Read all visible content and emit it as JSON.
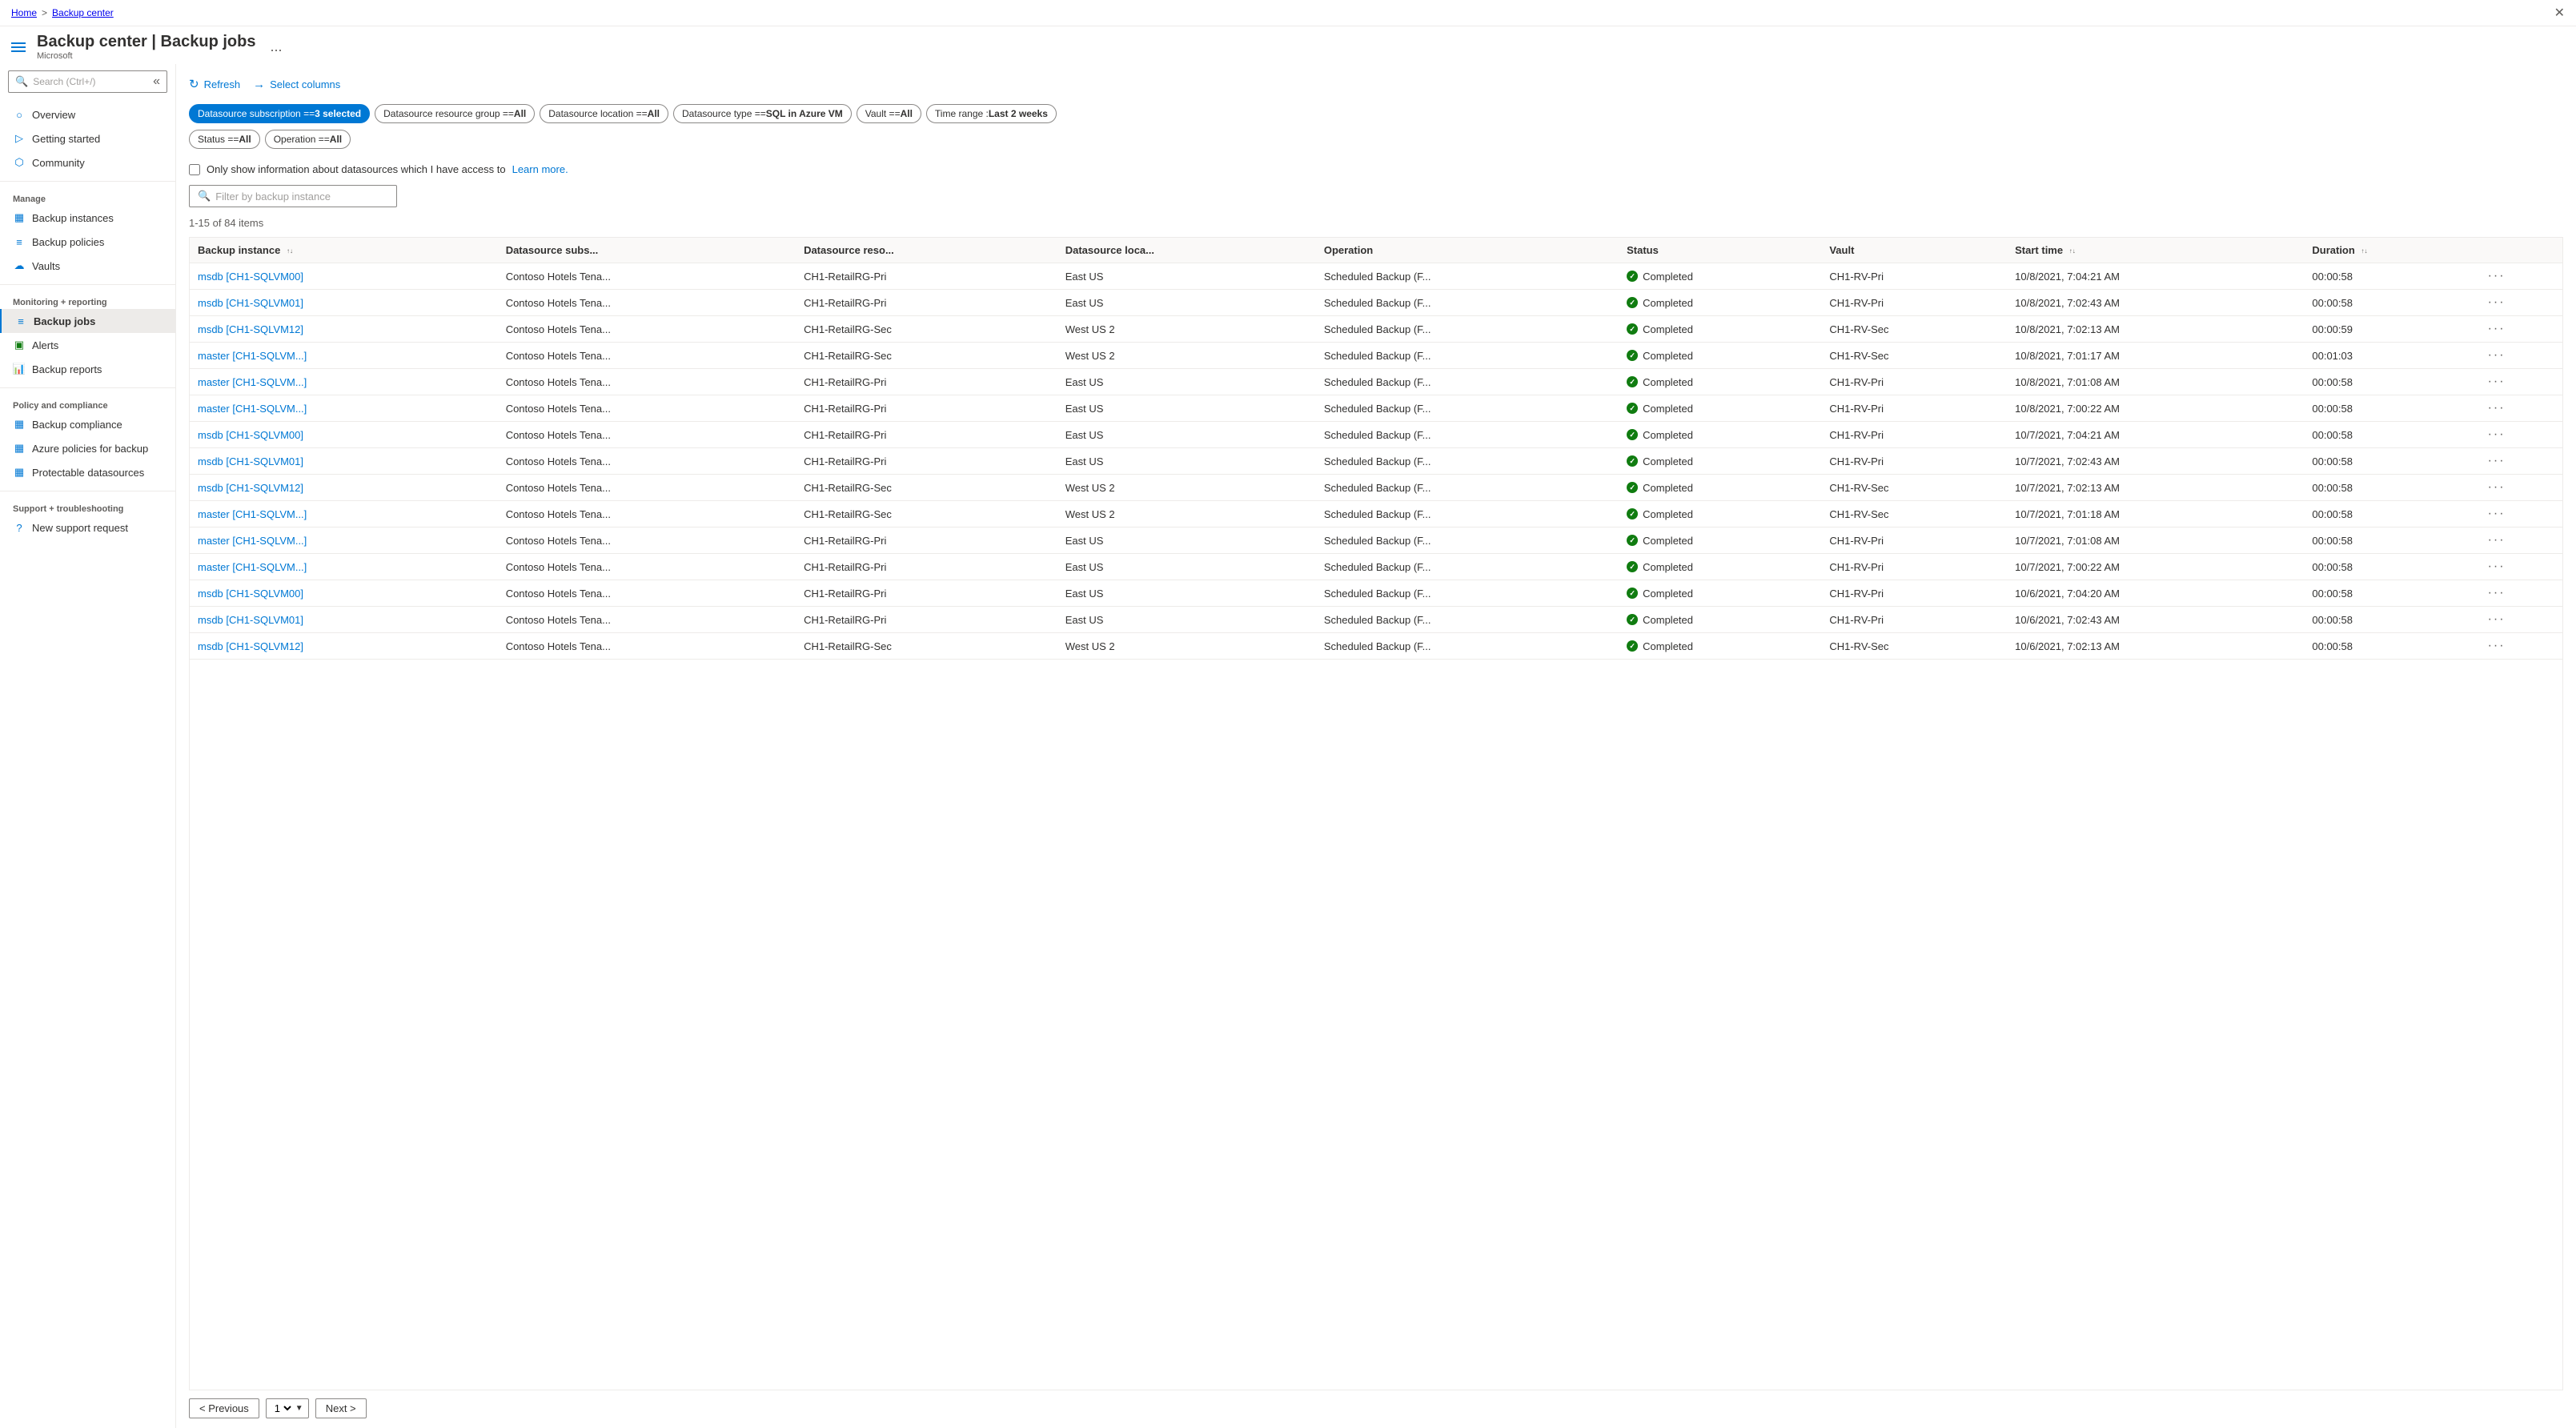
{
  "breadcrumb": {
    "home": "Home",
    "separator": ">",
    "current": "Backup center"
  },
  "header": {
    "title": "Backup center | Backup jobs",
    "subtitle": "Microsoft",
    "ellipsis": "..."
  },
  "sidebar": {
    "search_placeholder": "Search (Ctrl+/)",
    "collapse_label": "«",
    "items": [
      {
        "id": "overview",
        "label": "Overview",
        "icon": "○"
      },
      {
        "id": "getting-started",
        "label": "Getting started",
        "icon": "▷"
      },
      {
        "id": "community",
        "label": "Community",
        "icon": "⬡"
      }
    ],
    "sections": [
      {
        "label": "Manage",
        "items": [
          {
            "id": "backup-instances",
            "label": "Backup instances",
            "icon": "▦"
          },
          {
            "id": "backup-policies",
            "label": "Backup policies",
            "icon": "≡"
          },
          {
            "id": "vaults",
            "label": "Vaults",
            "icon": "☁"
          }
        ]
      },
      {
        "label": "Monitoring + reporting",
        "items": [
          {
            "id": "backup-jobs",
            "label": "Backup jobs",
            "icon": "≡",
            "active": true
          },
          {
            "id": "alerts",
            "label": "Alerts",
            "icon": "▣"
          },
          {
            "id": "backup-reports",
            "label": "Backup reports",
            "icon": "📊"
          }
        ]
      },
      {
        "label": "Policy and compliance",
        "items": [
          {
            "id": "backup-compliance",
            "label": "Backup compliance",
            "icon": "▦"
          },
          {
            "id": "azure-policies",
            "label": "Azure policies for backup",
            "icon": "▦"
          },
          {
            "id": "protectable-datasources",
            "label": "Protectable datasources",
            "icon": "▦"
          }
        ]
      },
      {
        "label": "Support + troubleshooting",
        "items": [
          {
            "id": "new-support",
            "label": "New support request",
            "icon": "?"
          }
        ]
      }
    ]
  },
  "toolbar": {
    "refresh_label": "Refresh",
    "select_columns_label": "Select columns"
  },
  "filters": [
    {
      "id": "subscription",
      "label": "Datasource subscription == 3 selected",
      "active": true
    },
    {
      "id": "resource-group",
      "label": "Datasource resource group == All",
      "active": false
    },
    {
      "id": "location",
      "label": "Datasource location == All",
      "active": false
    },
    {
      "id": "type",
      "label": "Datasource type == SQL in Azure VM",
      "active": false
    },
    {
      "id": "vault",
      "label": "Vault == All",
      "active": false
    },
    {
      "id": "time",
      "label": "Time range : Last 2 weeks",
      "active": false
    },
    {
      "id": "status",
      "label": "Status == All",
      "active": false
    },
    {
      "id": "operation",
      "label": "Operation == All",
      "active": false
    }
  ],
  "checkbox": {
    "label": "Only show information about datasources which I have access to",
    "link_text": "Learn more."
  },
  "filter_search": {
    "placeholder": "Filter by backup instance"
  },
  "items_count": "1-15 of 84 items",
  "table": {
    "columns": [
      {
        "id": "backup-instance",
        "label": "Backup instance",
        "sortable": true
      },
      {
        "id": "datasource-subs",
        "label": "Datasource subs...",
        "sortable": false
      },
      {
        "id": "datasource-reso",
        "label": "Datasource reso...",
        "sortable": false
      },
      {
        "id": "datasource-loca",
        "label": "Datasource loca...",
        "sortable": false
      },
      {
        "id": "operation",
        "label": "Operation",
        "sortable": false
      },
      {
        "id": "status",
        "label": "Status",
        "sortable": false
      },
      {
        "id": "vault",
        "label": "Vault",
        "sortable": false
      },
      {
        "id": "start-time",
        "label": "Start time",
        "sortable": true
      },
      {
        "id": "duration",
        "label": "Duration",
        "sortable": true
      },
      {
        "id": "actions",
        "label": "",
        "sortable": false
      }
    ],
    "rows": [
      {
        "instance": "msdb [CH1-SQLVM00]",
        "subs": "Contoso Hotels Tena...",
        "reso": "CH1-RetailRG-Pri",
        "loca": "East US",
        "operation": "Scheduled Backup (F...",
        "status": "Completed",
        "vault": "CH1-RV-Pri",
        "start": "10/8/2021, 7:04:21 AM",
        "duration": "00:00:58"
      },
      {
        "instance": "msdb [CH1-SQLVM01]",
        "subs": "Contoso Hotels Tena...",
        "reso": "CH1-RetailRG-Pri",
        "loca": "East US",
        "operation": "Scheduled Backup (F...",
        "status": "Completed",
        "vault": "CH1-RV-Pri",
        "start": "10/8/2021, 7:02:43 AM",
        "duration": "00:00:58"
      },
      {
        "instance": "msdb [CH1-SQLVM12]",
        "subs": "Contoso Hotels Tena...",
        "reso": "CH1-RetailRG-Sec",
        "loca": "West US 2",
        "operation": "Scheduled Backup (F...",
        "status": "Completed",
        "vault": "CH1-RV-Sec",
        "start": "10/8/2021, 7:02:13 AM",
        "duration": "00:00:59"
      },
      {
        "instance": "master [CH1-SQLVM...]",
        "subs": "Contoso Hotels Tena...",
        "reso": "CH1-RetailRG-Sec",
        "loca": "West US 2",
        "operation": "Scheduled Backup (F...",
        "status": "Completed",
        "vault": "CH1-RV-Sec",
        "start": "10/8/2021, 7:01:17 AM",
        "duration": "00:01:03"
      },
      {
        "instance": "master [CH1-SQLVM...]",
        "subs": "Contoso Hotels Tena...",
        "reso": "CH1-RetailRG-Pri",
        "loca": "East US",
        "operation": "Scheduled Backup (F...",
        "status": "Completed",
        "vault": "CH1-RV-Pri",
        "start": "10/8/2021, 7:01:08 AM",
        "duration": "00:00:58"
      },
      {
        "instance": "master [CH1-SQLVM...]",
        "subs": "Contoso Hotels Tena...",
        "reso": "CH1-RetailRG-Pri",
        "loca": "East US",
        "operation": "Scheduled Backup (F...",
        "status": "Completed",
        "vault": "CH1-RV-Pri",
        "start": "10/8/2021, 7:00:22 AM",
        "duration": "00:00:58"
      },
      {
        "instance": "msdb [CH1-SQLVM00]",
        "subs": "Contoso Hotels Tena...",
        "reso": "CH1-RetailRG-Pri",
        "loca": "East US",
        "operation": "Scheduled Backup (F...",
        "status": "Completed",
        "vault": "CH1-RV-Pri",
        "start": "10/7/2021, 7:04:21 AM",
        "duration": "00:00:58"
      },
      {
        "instance": "msdb [CH1-SQLVM01]",
        "subs": "Contoso Hotels Tena...",
        "reso": "CH1-RetailRG-Pri",
        "loca": "East US",
        "operation": "Scheduled Backup (F...",
        "status": "Completed",
        "vault": "CH1-RV-Pri",
        "start": "10/7/2021, 7:02:43 AM",
        "duration": "00:00:58"
      },
      {
        "instance": "msdb [CH1-SQLVM12]",
        "subs": "Contoso Hotels Tena...",
        "reso": "CH1-RetailRG-Sec",
        "loca": "West US 2",
        "operation": "Scheduled Backup (F...",
        "status": "Completed",
        "vault": "CH1-RV-Sec",
        "start": "10/7/2021, 7:02:13 AM",
        "duration": "00:00:58"
      },
      {
        "instance": "master [CH1-SQLVM...]",
        "subs": "Contoso Hotels Tena...",
        "reso": "CH1-RetailRG-Sec",
        "loca": "West US 2",
        "operation": "Scheduled Backup (F...",
        "status": "Completed",
        "vault": "CH1-RV-Sec",
        "start": "10/7/2021, 7:01:18 AM",
        "duration": "00:00:58"
      },
      {
        "instance": "master [CH1-SQLVM...]",
        "subs": "Contoso Hotels Tena...",
        "reso": "CH1-RetailRG-Pri",
        "loca": "East US",
        "operation": "Scheduled Backup (F...",
        "status": "Completed",
        "vault": "CH1-RV-Pri",
        "start": "10/7/2021, 7:01:08 AM",
        "duration": "00:00:58"
      },
      {
        "instance": "master [CH1-SQLVM...]",
        "subs": "Contoso Hotels Tena...",
        "reso": "CH1-RetailRG-Pri",
        "loca": "East US",
        "operation": "Scheduled Backup (F...",
        "status": "Completed",
        "vault": "CH1-RV-Pri",
        "start": "10/7/2021, 7:00:22 AM",
        "duration": "00:00:58"
      },
      {
        "instance": "msdb [CH1-SQLVM00]",
        "subs": "Contoso Hotels Tena...",
        "reso": "CH1-RetailRG-Pri",
        "loca": "East US",
        "operation": "Scheduled Backup (F...",
        "status": "Completed",
        "vault": "CH1-RV-Pri",
        "start": "10/6/2021, 7:04:20 AM",
        "duration": "00:00:58"
      },
      {
        "instance": "msdb [CH1-SQLVM01]",
        "subs": "Contoso Hotels Tena...",
        "reso": "CH1-RetailRG-Pri",
        "loca": "East US",
        "operation": "Scheduled Backup (F...",
        "status": "Completed",
        "vault": "CH1-RV-Pri",
        "start": "10/6/2021, 7:02:43 AM",
        "duration": "00:00:58"
      },
      {
        "instance": "msdb [CH1-SQLVM12]",
        "subs": "Contoso Hotels Tena...",
        "reso": "CH1-RetailRG-Sec",
        "loca": "West US 2",
        "operation": "Scheduled Backup (F...",
        "status": "Completed",
        "vault": "CH1-RV-Sec",
        "start": "10/6/2021, 7:02:13 AM",
        "duration": "00:00:58"
      }
    ]
  },
  "pagination": {
    "prev_label": "< Previous",
    "next_label": "Next >",
    "current_page": "1"
  }
}
